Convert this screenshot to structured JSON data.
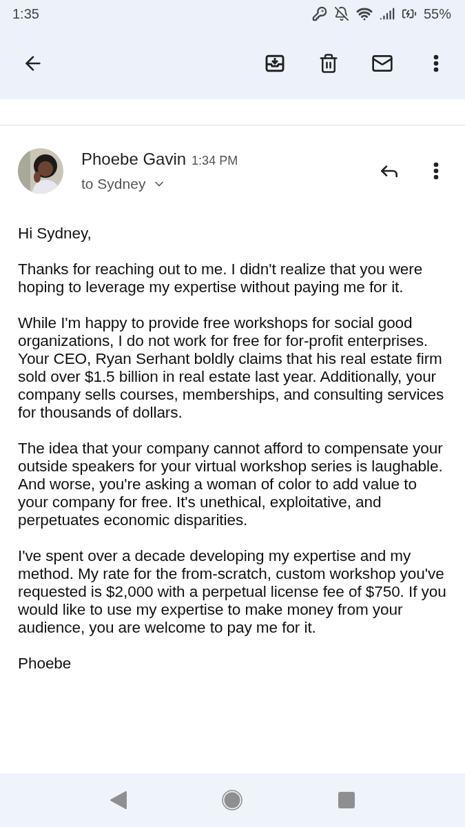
{
  "status_bar": {
    "time": "1:35",
    "battery": "55%"
  },
  "message": {
    "sender": "Phoebe Gavin",
    "time": "1:34 PM",
    "recipient": "to Sydney"
  },
  "body": [
    "Hi Sydney,",
    "Thanks for reaching out to me. I didn't realize that you were hoping to leverage my expertise without paying me for it.",
    "While I'm happy to provide free workshops for social good organizations, I do not work for free for for-profit enterprises. Your CEO, Ryan Serhant boldly claims that his real estate firm sold over $1.5 billion in real estate last year. Additionally, your company sells courses, memberships, and consulting services for thousands of dollars.",
    "The idea that your company cannot afford to compensate your outside speakers for your virtual workshop series is laughable. And worse, you're asking a woman of color to add value to your company for free. It's unethical, exploitative, and perpetuates economic disparities.",
    "I've spent over a decade developing my expertise and my method. My rate for the from-scratch, custom workshop you've requested is $2,000 with a perpetual license fee of $750. If you would like to use my expertise to make money from your audience, you are welcome to pay me for it.",
    "Phoebe"
  ]
}
